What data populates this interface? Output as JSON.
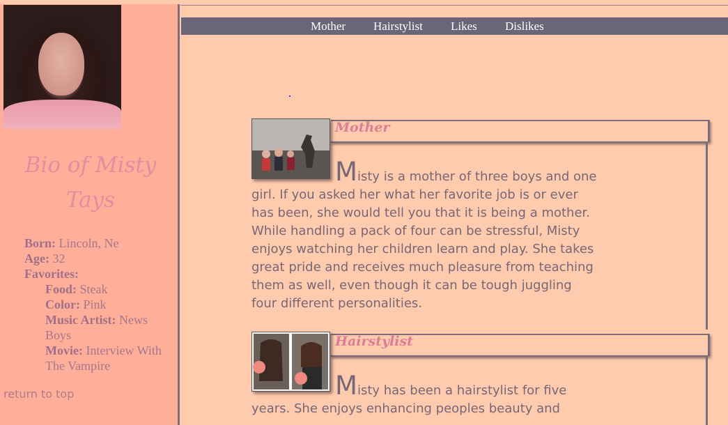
{
  "sidebar": {
    "title": "Bio of Misty Tays",
    "facts": [
      {
        "label": "Born:",
        "value": " Lincoln, Ne",
        "indent": false
      },
      {
        "label": "Age:",
        "value": " 32",
        "indent": false
      },
      {
        "label": "Favorites:",
        "value": "",
        "indent": false
      },
      {
        "label": "Food:",
        "value": " Steak",
        "indent": true
      },
      {
        "label": "Color:",
        "value": " Pink",
        "indent": true
      },
      {
        "label": "Music Artist:",
        "value": " News Boys",
        "indent": true
      },
      {
        "label": "Movie:",
        "value": " Interview With The Vampire",
        "indent": true
      }
    ],
    "return_link": "return to top"
  },
  "nav": {
    "items": [
      "Mother",
      "Hairstylist",
      "Likes",
      "Dislikes"
    ]
  },
  "sections": [
    {
      "title": "Mother",
      "dropcap": "M",
      "text": "isty is a mother of three boys and one girl. If you asked her what her favorite job is or ever has been, she would tell you that it is being a mother. While handling a pack of four can be stressful, Misty enjoys watching her children learn and play. She takes great pride and receives much pleasure from teaching them as well, even though it can be tough juggling four different personalities."
    },
    {
      "title": "Hairstylist",
      "dropcap": "M",
      "text": "isty has been a hairstylist for five years. She enjoys enhancing peoples beauty and"
    }
  ]
}
